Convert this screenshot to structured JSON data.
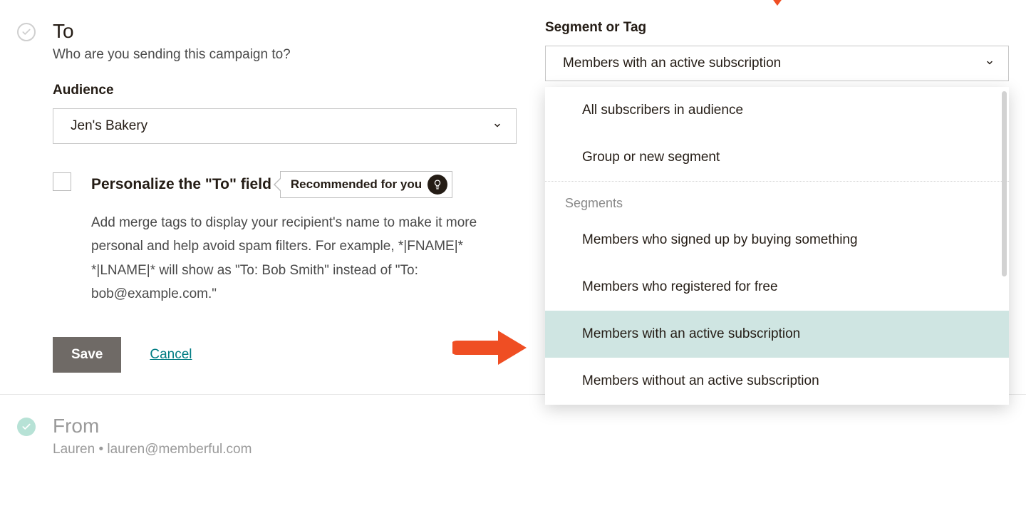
{
  "to": {
    "title": "To",
    "subtitle": "Who are you sending this campaign to?",
    "audience_label": "Audience",
    "audience_value": "Jen's Bakery",
    "personalize_title": "Personalize the \"To\" field",
    "recommended_label": "Recommended for you",
    "personalize_desc": "Add merge tags to display your recipient's name to make it more personal and help avoid spam filters. For example, *|FNAME|* *|LNAME|* will show as \"To: Bob Smith\" instead of \"To: bob@example.com.\"",
    "save_label": "Save",
    "cancel_label": "Cancel"
  },
  "segment": {
    "label": "Segment or Tag",
    "selected": "Members with an active subscription",
    "top_options": [
      "All subscribers in audience",
      "Group or new segment"
    ],
    "group_label": "Segments",
    "seg_options": [
      "Members who signed up by buying something",
      "Members who registered for free",
      "Members with an active subscription",
      "Members without an active subscription"
    ],
    "selected_index": 2
  },
  "from": {
    "title": "From",
    "name": "Lauren",
    "separator": " • ",
    "email": "lauren@memberful.com"
  }
}
